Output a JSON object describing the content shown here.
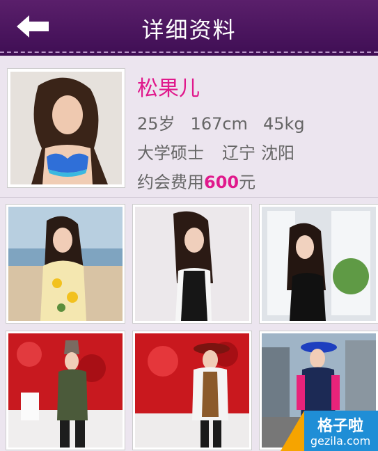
{
  "header": {
    "title": "详细资料",
    "back_icon": "back-arrow-icon",
    "bg_color": "#4a1460"
  },
  "profile": {
    "name": "松果儿",
    "age": "25岁",
    "height": "167cm",
    "weight": "45kg",
    "education": "大学硕士",
    "province": "辽宁",
    "city": "沈阳",
    "fee_label": "约会费用",
    "fee_value": "600",
    "fee_unit": "元",
    "accent_color": "#e0198c"
  },
  "gallery": {
    "photos": [
      {
        "scene": "beach"
      },
      {
        "scene": "studio"
      },
      {
        "scene": "window-plant"
      },
      {
        "scene": "red-flower-wall"
      },
      {
        "scene": "red-flower-wall"
      },
      {
        "scene": "city-street"
      }
    ]
  },
  "watermark": {
    "cn": "格子啦",
    "en": "gezila.com"
  }
}
